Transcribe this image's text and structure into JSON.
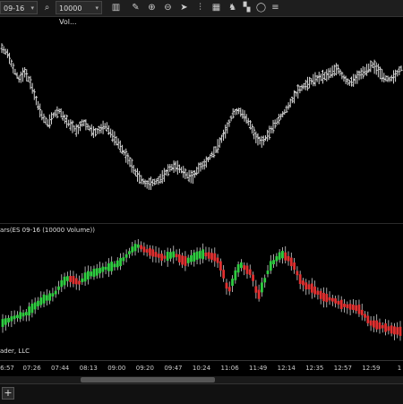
{
  "toolbar": {
    "instrument": "09-16",
    "bar_type": "10000 Vol...",
    "icons": [
      "search-icon",
      "chart-style-icon",
      "pencil-icon",
      "zoom-in-icon",
      "zoom-out-icon",
      "cursor-icon",
      "bars-icon",
      "data-series-icon",
      "strategies-icon",
      "properties-icon"
    ]
  },
  "price_panel": {
    "label": ""
  },
  "indicator_panel": {
    "label": "ars(ES 09-16 (10000 Volume))",
    "up_color": "#2ecc40",
    "down_color": "#e03030",
    "wick_color": "#cfcfcf"
  },
  "footer": {
    "copyright": "ader, LLC"
  },
  "time_axis": {
    "ticks": [
      "6:57",
      "07:26",
      "07:44",
      "08:13",
      "09:00",
      "09:20",
      "09:47",
      "10:24",
      "11:06",
      "11:49",
      "12:14",
      "12:35",
      "12:57",
      "12:59",
      "1"
    ]
  },
  "bottom_bar": {
    "add_tab_label": "+"
  },
  "chart_data": [
    {
      "type": "ohlc",
      "title": "",
      "series": [
        {
          "name": "ES 09-16",
          "values": [
            0.89,
            0.86,
            0.78,
            0.72,
            0.76,
            0.7,
            0.6,
            0.52,
            0.48,
            0.53,
            0.55,
            0.5,
            0.47,
            0.44,
            0.49,
            0.46,
            0.43,
            0.45,
            0.47,
            0.42,
            0.38,
            0.33,
            0.28,
            0.22,
            0.18,
            0.15,
            0.16,
            0.17,
            0.2,
            0.24,
            0.25,
            0.23,
            0.2,
            0.19,
            0.24,
            0.26,
            0.3,
            0.34,
            0.4,
            0.46,
            0.54,
            0.55,
            0.52,
            0.47,
            0.4,
            0.38,
            0.42,
            0.47,
            0.51,
            0.55,
            0.6,
            0.65,
            0.68,
            0.7,
            0.72,
            0.73,
            0.74,
            0.76,
            0.78,
            0.73,
            0.7,
            0.72,
            0.75,
            0.77,
            0.8,
            0.77,
            0.73,
            0.72,
            0.74,
            0.78
          ]
        }
      ]
    },
    {
      "type": "bar",
      "title": "ars(ES 09-16 (10000 Volume))",
      "series": [
        {
          "name": "ES 09-16 (10000 Volume)",
          "values": [
            0.12,
            0.15,
            0.18,
            0.2,
            0.22,
            0.28,
            0.33,
            0.38,
            0.4,
            0.45,
            0.55,
            0.6,
            0.58,
            0.55,
            0.62,
            0.65,
            0.67,
            0.7,
            0.72,
            0.74,
            0.78,
            0.85,
            0.92,
            0.95,
            0.9,
            0.88,
            0.85,
            0.82,
            0.84,
            0.86,
            0.8,
            0.78,
            0.82,
            0.85,
            0.86,
            0.84,
            0.82,
            0.7,
            0.45,
            0.6,
            0.75,
            0.7,
            0.65,
            0.4,
            0.55,
            0.72,
            0.8,
            0.86,
            0.82,
            0.75,
            0.6,
            0.52,
            0.5,
            0.45,
            0.4,
            0.38,
            0.36,
            0.32,
            0.3,
            0.29,
            0.27,
            0.2,
            0.12,
            0.1,
            0.08,
            0.06,
            0.04,
            0.03
          ]
        }
      ]
    }
  ]
}
